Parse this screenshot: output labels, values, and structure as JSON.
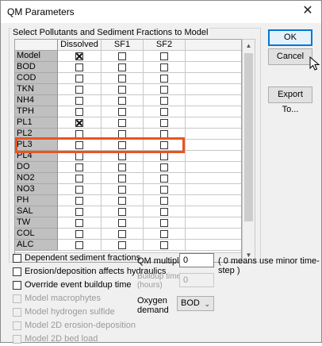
{
  "window": {
    "title": "QM Parameters",
    "close_glyph": "✕"
  },
  "grid": {
    "group_label": "Select Pollutants and Sediment Fractions to Model",
    "columns": [
      "Dissolved",
      "SF1",
      "SF2"
    ],
    "rows": [
      {
        "name": "Model",
        "checks": [
          true,
          false,
          false
        ]
      },
      {
        "name": "BOD",
        "checks": [
          false,
          false,
          false
        ]
      },
      {
        "name": "COD",
        "checks": [
          false,
          false,
          false
        ]
      },
      {
        "name": "TKN",
        "checks": [
          false,
          false,
          false
        ]
      },
      {
        "name": "NH4",
        "checks": [
          false,
          false,
          false
        ]
      },
      {
        "name": "TPH",
        "checks": [
          false,
          false,
          false
        ]
      },
      {
        "name": "PL1",
        "checks": [
          true,
          false,
          false
        ]
      },
      {
        "name": "PL2",
        "checks": [
          false,
          false,
          false
        ]
      },
      {
        "name": "PL3",
        "checks": [
          false,
          false,
          false
        ]
      },
      {
        "name": "PL4",
        "checks": [
          false,
          false,
          false
        ]
      },
      {
        "name": "DO",
        "checks": [
          false,
          false,
          false
        ]
      },
      {
        "name": "NO2",
        "checks": [
          false,
          false,
          false
        ]
      },
      {
        "name": "NO3",
        "checks": [
          false,
          false,
          false
        ]
      },
      {
        "name": "PH",
        "checks": [
          false,
          false,
          false
        ]
      },
      {
        "name": "SAL",
        "checks": [
          false,
          false,
          false
        ]
      },
      {
        "name": "TW",
        "checks": [
          false,
          false,
          false
        ]
      },
      {
        "name": "COL",
        "checks": [
          false,
          false,
          false
        ]
      },
      {
        "name": "ALC",
        "checks": [
          false,
          false,
          false
        ]
      }
    ]
  },
  "buttons": {
    "ok": "OK",
    "cancel": "Cancel",
    "export": "Export To..."
  },
  "options": {
    "dependent_sediment": "Dependent sediment fractions",
    "erosion_hydraulics": "Erosion/deposition affects hydraulics",
    "override_buildup": "Override event buildup time",
    "macrophytes": "Model macrophytes",
    "hydrogen_sulfide": "Model hydrogen sulfide",
    "erosion_2d": "Model 2D erosion-deposition",
    "bed_load_2d": "Model 2D bed load"
  },
  "qm_multiplier": {
    "label": "QM multiplier",
    "value": "0",
    "note": "( 0 means use minor time-step )"
  },
  "buildup_time": {
    "label_line1": "Buildup time",
    "label_line2": "(hours)",
    "value": "0"
  },
  "oxygen_demand": {
    "label_line1": "Oxygen",
    "label_line2": "demand",
    "value": "BOD",
    "arrow": "⌄"
  },
  "colors": {
    "highlight": "#e8551f",
    "default_button": "#0078d7"
  }
}
